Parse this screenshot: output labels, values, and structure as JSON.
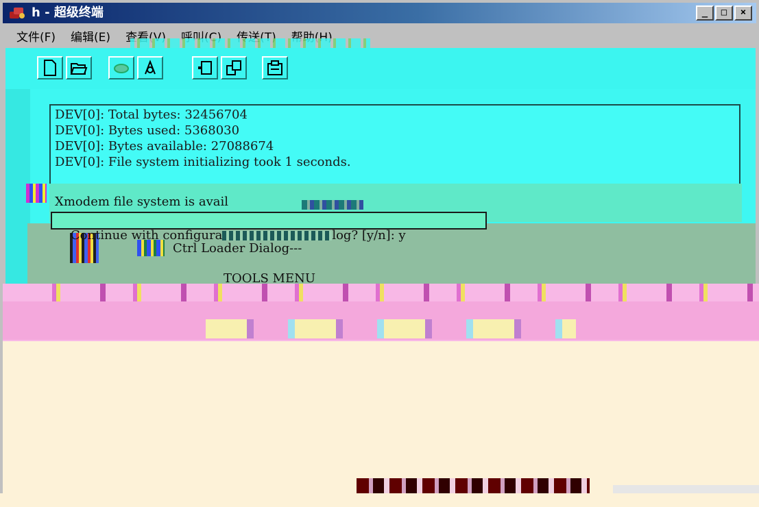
{
  "window": {
    "title": "h - 超级终端",
    "controls": {
      "minimize": "_",
      "maximize": "□",
      "close": "×"
    }
  },
  "menubar": {
    "items": [
      "文件(F)",
      "编辑(E)",
      "查看(V)",
      "呼叫(C)",
      "传送(T)",
      "帮助(H)"
    ]
  },
  "toolbar": {
    "icons": [
      "new-icon",
      "open-icon",
      "connect-icon",
      "disconnect-icon",
      "send-icon",
      "receive-icon",
      "properties-icon"
    ]
  },
  "terminal": {
    "lines": [
      "DEV[0]: Total bytes: 32456704",
      "DEV[0]: Bytes used: 5368030",
      "DEV[0]: Bytes available: 27088674",
      "DEV[0]: File system initializing took 1 seconds."
    ],
    "xmodem_line": "Xmodem file system is avail",
    "prompt_prefix": "Continue with configura",
    "prompt_suffix": "log? [y/n]: y",
    "loader_line": "Ctrl Loader Dialog---",
    "menu_title": "TOOLS MENU"
  },
  "colors": {
    "terminal_bg": "#44fbf6",
    "titlebar": "#0a246a",
    "band_green": "#5fe9c8",
    "gray_band": "#8fbea0",
    "pink_band": "#f8b8e6",
    "cream": "#fdf2d8"
  }
}
